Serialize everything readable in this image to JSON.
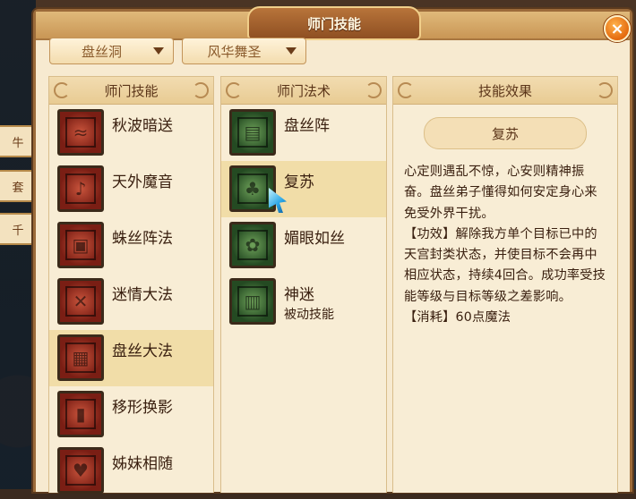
{
  "background": {
    "side_tabs": [
      "牛",
      "套",
      "千"
    ]
  },
  "dialog": {
    "title": "师门技能",
    "close_label": "×",
    "dropdowns": [
      {
        "value": "盘丝洞"
      },
      {
        "value": "风华舞圣"
      }
    ],
    "panels": {
      "school_skills": {
        "header": "师门技能",
        "selected_index": 4,
        "items": [
          {
            "name": "秋波暗送",
            "icon": "wave-sigil-icon"
          },
          {
            "name": "天外魔音",
            "icon": "lute-sigil-icon"
          },
          {
            "name": "蛛丝阵法",
            "icon": "square-web-icon"
          },
          {
            "name": "迷情大法",
            "icon": "charm-sigil-icon"
          },
          {
            "name": "盘丝大法",
            "icon": "grid-sigil-icon"
          },
          {
            "name": "移形换影",
            "icon": "shadow-sigil-icon"
          },
          {
            "name": "姊妹相随",
            "icon": "heart-sigil-icon"
          }
        ]
      },
      "school_spells": {
        "header": "师门法术",
        "selected_index": 1,
        "items": [
          {
            "name": "盘丝阵",
            "sub": "",
            "icon": "web-formation-icon"
          },
          {
            "name": "复苏",
            "sub": "",
            "icon": "revive-tree-icon"
          },
          {
            "name": "媚眼如丝",
            "sub": "",
            "icon": "spiral-eye-icon"
          },
          {
            "name": "神迷",
            "sub": "被动技能",
            "icon": "maze-icon"
          }
        ]
      },
      "skill_effect": {
        "header": "技能效果",
        "skill_name": "复苏",
        "paragraphs": [
          "心定则遇乱不惊，心安则精神振奋。盘丝弟子懂得如何安定身心来免受外界干扰。",
          "【功效】解除我方单个目标已中的天宫封类状态，并使目标不会再中相应状态，持续4回合。成功率受技能等级与目标等级之差影响。",
          "【消耗】60点魔法"
        ]
      }
    }
  },
  "colors": {
    "panel_bg": "#f8edd5",
    "selected_row": "#f1dda8",
    "title_plate": "#8e4f22",
    "close_button": "#e46a0f"
  }
}
